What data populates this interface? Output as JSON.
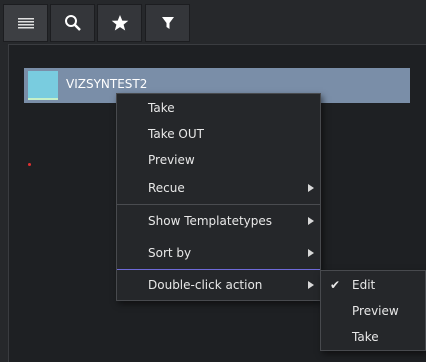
{
  "toolbar": {
    "buttons": [
      {
        "name": "menu",
        "icon": "hamburger-icon"
      },
      {
        "name": "search",
        "icon": "search-icon"
      },
      {
        "name": "favorites",
        "icon": "star-icon"
      },
      {
        "name": "filter",
        "icon": "filter-icon"
      }
    ]
  },
  "list": {
    "items": [
      {
        "label": "VIZSYNTEST2",
        "thumb_color": "#79ccdf"
      }
    ]
  },
  "context_menu": {
    "items": [
      {
        "label": "Take"
      },
      {
        "label": "Take OUT"
      },
      {
        "label": "Preview"
      },
      {
        "label": "Recue",
        "has_submenu": true
      },
      {
        "label": "Show Templatetypes",
        "has_submenu": true
      },
      {
        "label": "Sort by",
        "has_submenu": true
      },
      {
        "label": "Double-click action",
        "has_submenu": true,
        "open": true
      }
    ]
  },
  "submenu": {
    "items": [
      {
        "label": "Edit",
        "checked": true
      },
      {
        "label": "Preview",
        "checked": false
      },
      {
        "label": "Take",
        "checked": false
      }
    ]
  },
  "colors": {
    "background": "#26282b",
    "selected_item": "#7a8ea8",
    "menu_accent": "#6e6ad8"
  }
}
